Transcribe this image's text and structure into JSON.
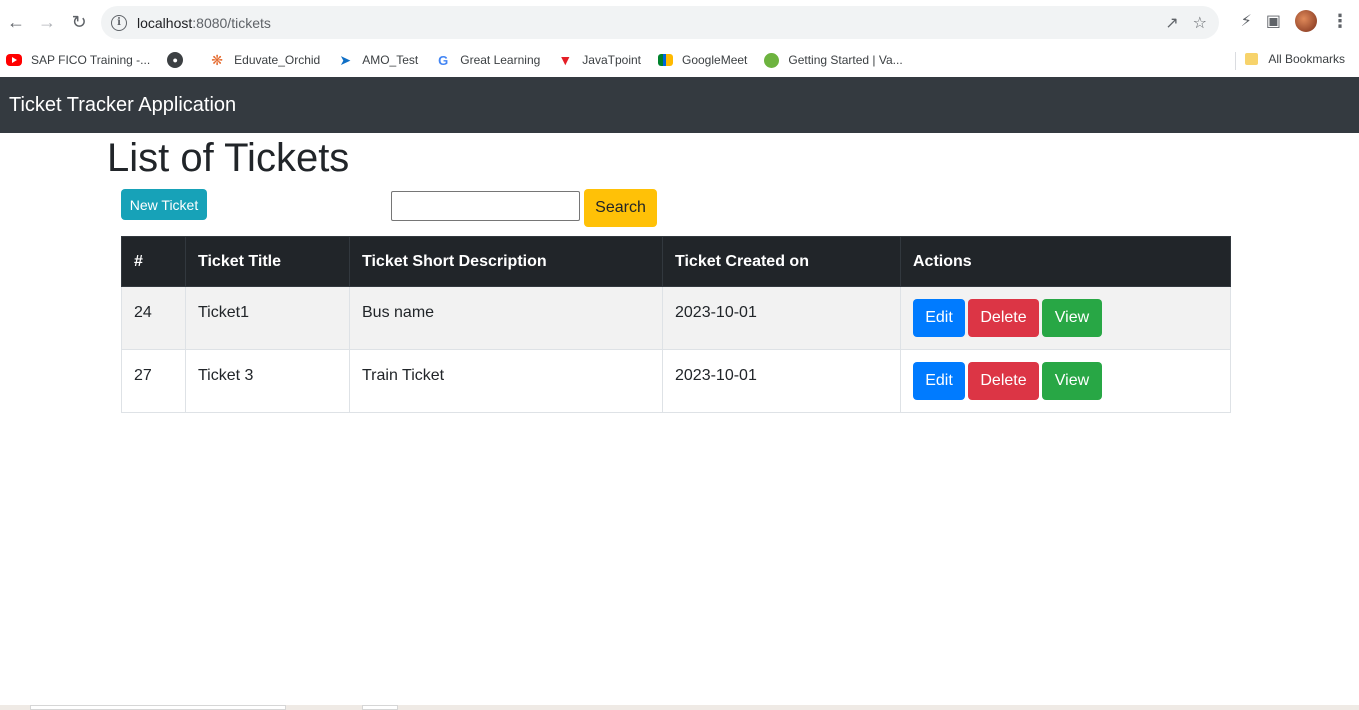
{
  "browser": {
    "url_host": "localhost",
    "url_path": ":8080/tickets"
  },
  "bookmarks": [
    {
      "label": "SAP FICO Training -...",
      "icon": "youtube-icon"
    },
    {
      "label": "",
      "icon": "globe-icon"
    },
    {
      "label": "Eduvate_Orchid",
      "icon": "orchid-icon"
    },
    {
      "label": "AMO_Test",
      "icon": "amo-icon"
    },
    {
      "label": "Great Learning",
      "icon": "g-icon"
    },
    {
      "label": "JavaTpoint",
      "icon": "javatpoint-icon"
    },
    {
      "label": "GoogleMeet",
      "icon": "meet-icon"
    },
    {
      "label": "Getting Started | Va...",
      "icon": "spring-icon"
    }
  ],
  "all_bookmarks_label": "All Bookmarks",
  "app": {
    "brand": "Ticket Tracker Application"
  },
  "page": {
    "title": "List of Tickets",
    "new_ticket_label": "New Ticket",
    "search_value": "",
    "search_label": "Search"
  },
  "table": {
    "headers": [
      "#",
      "Ticket Title",
      "Ticket Short Description",
      "Ticket Created on",
      "Actions"
    ],
    "rows": [
      {
        "id": "24",
        "title": "Ticket1",
        "description": "Bus name",
        "created": "2023-10-01"
      },
      {
        "id": "27",
        "title": "Ticket 3",
        "description": "Train Ticket",
        "created": "2023-10-01"
      }
    ],
    "actions": {
      "edit": "Edit",
      "delete": "Delete",
      "view": "View"
    }
  },
  "colors": {
    "navbar": "#343a40",
    "info": "#17a2b8",
    "warning": "#ffc107",
    "primary": "#007bff",
    "danger": "#dc3545",
    "success": "#28a745"
  }
}
